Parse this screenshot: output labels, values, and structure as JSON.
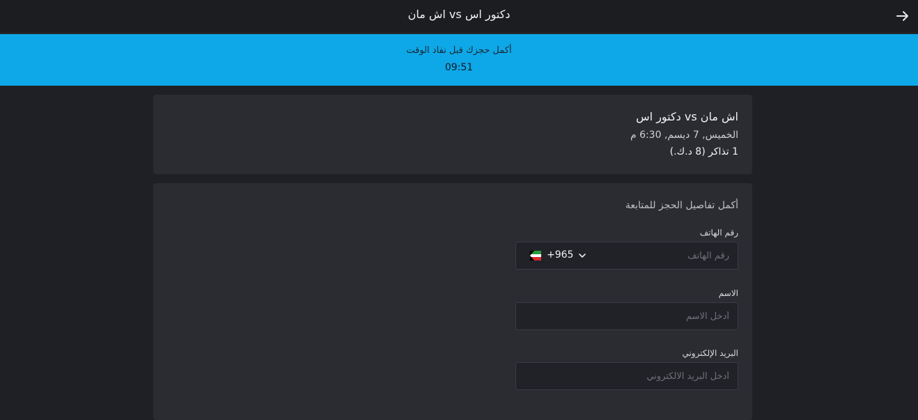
{
  "header": {
    "title": "اش مان vs دكتور اس",
    "back_icon": "arrow-right-icon"
  },
  "timer": {
    "message": "أكمل حجزك قبل نفاد الوقت",
    "time": "09:51",
    "color": "#0ea8e8"
  },
  "event": {
    "name": "اش مان vs دكتور اس",
    "date": "الخميس, 7 ديسم, 6:30 م",
    "tickets": "1 تذاكر (8 د.ك.)"
  },
  "form": {
    "heading": "أكمل تفاصيل الحجز للمتابعة",
    "phone": {
      "label": "رقم الهاتف",
      "placeholder": "رقم الهاتف",
      "country_code": "+965",
      "flag_icon": "kuwait-flag-icon"
    },
    "name": {
      "label": "الاسم",
      "placeholder": "أدخل الاسم"
    },
    "email": {
      "label": "البريد الإلكتروني",
      "placeholder": "أدخل البريد الالكتروني"
    }
  }
}
